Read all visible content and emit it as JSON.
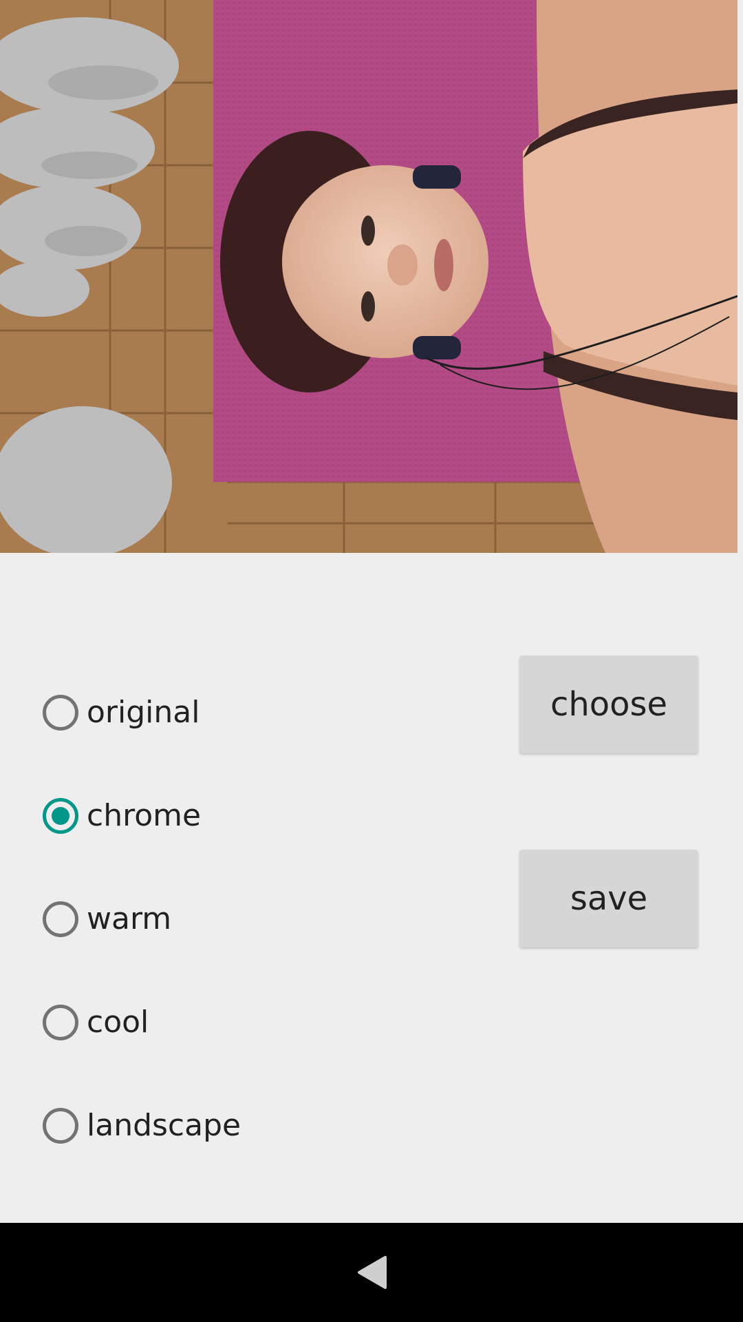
{
  "photo": {
    "description_icon": "photo-preview"
  },
  "filters": {
    "options": [
      {
        "label": "original",
        "checked": false
      },
      {
        "label": "chrome",
        "checked": true
      },
      {
        "label": "warm",
        "checked": false
      },
      {
        "label": "cool",
        "checked": false
      },
      {
        "label": "landscape",
        "checked": false
      }
    ]
  },
  "buttons": {
    "choose_label": "choose",
    "save_label": "save"
  },
  "navbar": {
    "back_icon": "back-triangle-icon"
  },
  "colors": {
    "accent": "#009688",
    "background": "#eeeeee",
    "button": "#d6d6d6",
    "navbar": "#000000"
  }
}
